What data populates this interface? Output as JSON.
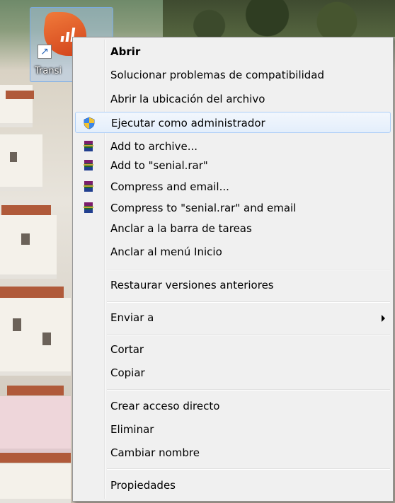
{
  "desktop": {
    "icon_label": "Transi"
  },
  "context_menu": {
    "items": [
      {
        "label": "Abrir",
        "bold": true
      },
      {
        "label": "Solucionar problemas de compatibilidad"
      },
      {
        "label": "Abrir la ubicación del archivo"
      },
      {
        "label": "Ejecutar como administrador",
        "icon": "uac-shield-icon"
      },
      {
        "label": "Add to archive...",
        "icon": "winrar-icon"
      },
      {
        "label": "Add to \"senial.rar\"",
        "icon": "winrar-icon"
      },
      {
        "label": "Compress and email...",
        "icon": "winrar-icon"
      },
      {
        "label": "Compress to \"senial.rar\" and email",
        "icon": "winrar-icon"
      },
      {
        "label": "Anclar a la barra de tareas"
      },
      {
        "label": "Anclar al menú Inicio"
      },
      {
        "label": "Restaurar versiones anteriores"
      },
      {
        "label": "Enviar a",
        "submenu": true
      },
      {
        "label": "Cortar"
      },
      {
        "label": "Copiar"
      },
      {
        "label": "Crear acceso directo"
      },
      {
        "label": "Eliminar"
      },
      {
        "label": "Cambiar nombre"
      },
      {
        "label": "Propiedades"
      }
    ]
  },
  "colors": {
    "menu_background": "#f0f0f0",
    "hover_border": "#aecff7",
    "icon_tile": "#d2431b"
  }
}
